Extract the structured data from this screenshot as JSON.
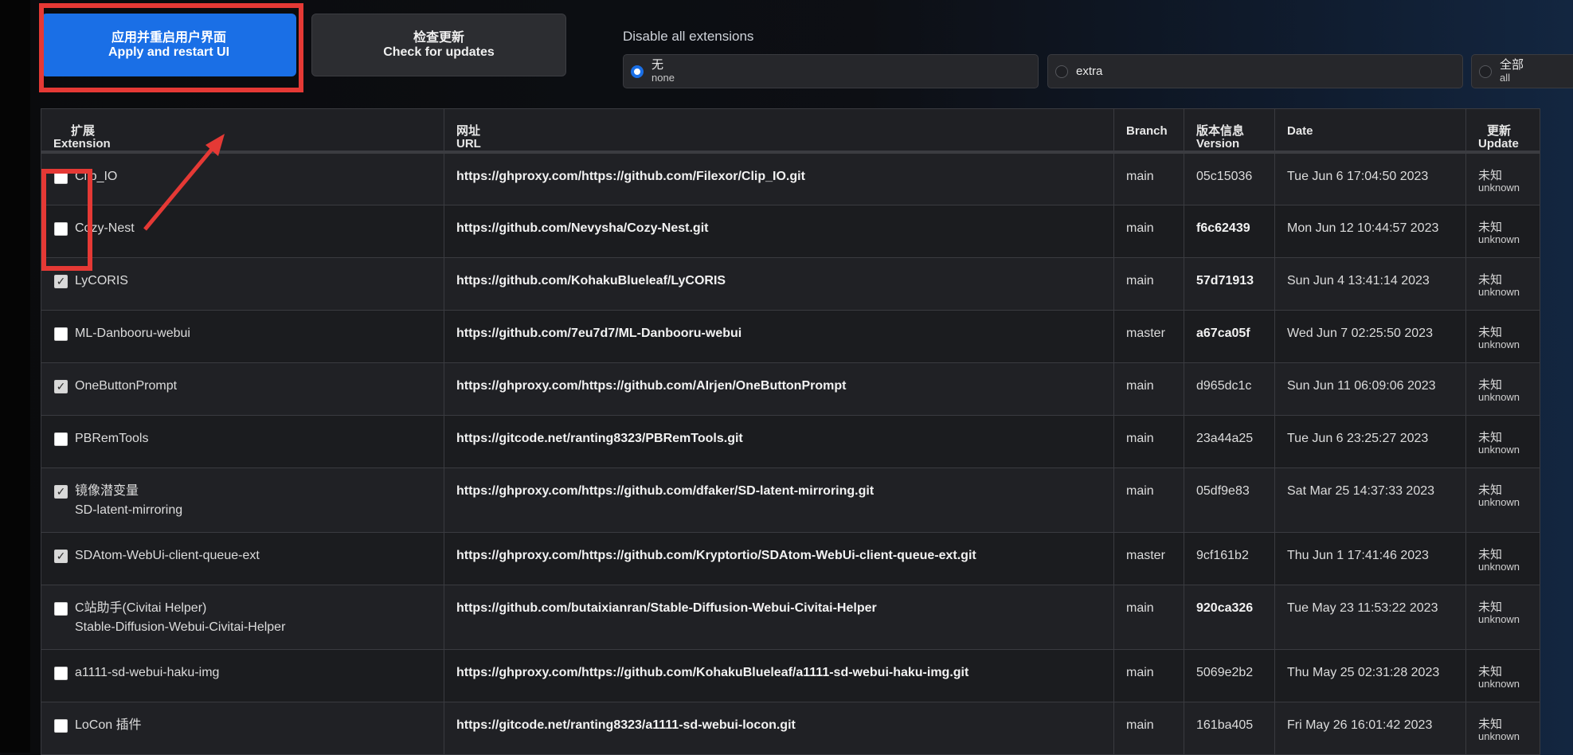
{
  "buttons": {
    "apply": {
      "cn": "应用并重启用户界面",
      "en": "Apply and restart UI"
    },
    "check": {
      "cn": "检查更新",
      "en": "Check for updates"
    }
  },
  "disable": {
    "label": "Disable all extensions",
    "options": [
      {
        "main": "无",
        "sub": "none",
        "checked": true
      },
      {
        "main": "extra",
        "sub": "",
        "checked": false
      },
      {
        "main": "全部",
        "sub": "all",
        "checked": false
      }
    ]
  },
  "table": {
    "headers": {
      "extension": {
        "cn": "扩展",
        "en": "Extension"
      },
      "url": {
        "cn": "网址",
        "en": "URL"
      },
      "branch": {
        "cn": "",
        "en": "Branch"
      },
      "version": {
        "cn": "版本信息",
        "en": "Version"
      },
      "date": {
        "cn": "",
        "en": "Date"
      },
      "update": {
        "cn": "更新",
        "en": "Update"
      }
    },
    "rows": [
      {
        "checked": false,
        "name": "Clip_IO",
        "name2": "",
        "url": "https://ghproxy.com/https://github.com/Filexor/Clip_IO.git",
        "branch": "main",
        "version": "05c15036",
        "version_bold": false,
        "date": "Tue Jun 6 17:04:50 2023",
        "update": "未知",
        "update_sub": "unknown"
      },
      {
        "checked": false,
        "name": "Cozy-Nest",
        "name2": "",
        "url": "https://github.com/Nevysha/Cozy-Nest.git",
        "branch": "main",
        "version": "f6c62439",
        "version_bold": true,
        "date": "Mon Jun 12 10:44:57 2023",
        "update": "未知",
        "update_sub": "unknown"
      },
      {
        "checked": true,
        "name": "LyCORIS",
        "name2": "",
        "url": "https://github.com/KohakuBlueleaf/LyCORIS",
        "branch": "main",
        "version": "57d71913",
        "version_bold": true,
        "date": "Sun Jun 4 13:41:14 2023",
        "update": "未知",
        "update_sub": "unknown"
      },
      {
        "checked": false,
        "name": "ML-Danbooru-webui",
        "name2": "",
        "url": "https://github.com/7eu7d7/ML-Danbooru-webui",
        "branch": "master",
        "version": "a67ca05f",
        "version_bold": true,
        "date": "Wed Jun 7 02:25:50 2023",
        "update": "未知",
        "update_sub": "unknown"
      },
      {
        "checked": true,
        "name": "OneButtonPrompt",
        "name2": "",
        "url": "https://ghproxy.com/https://github.com/AIrjen/OneButtonPrompt",
        "branch": "main",
        "version": "d965dc1c",
        "version_bold": false,
        "date": "Sun Jun 11 06:09:06 2023",
        "update": "未知",
        "update_sub": "unknown"
      },
      {
        "checked": false,
        "name": "PBRemTools",
        "name2": "",
        "url": "https://gitcode.net/ranting8323/PBRemTools.git",
        "branch": "main",
        "version": "23a44a25",
        "version_bold": false,
        "date": "Tue Jun 6 23:25:27 2023",
        "update": "未知",
        "update_sub": "unknown"
      },
      {
        "checked": true,
        "name": "镜像潜变量",
        "name2": "SD-latent-mirroring",
        "url": "https://ghproxy.com/https://github.com/dfaker/SD-latent-mirroring.git",
        "branch": "main",
        "version": "05df9e83",
        "version_bold": false,
        "date": "Sat Mar 25 14:37:33 2023",
        "update": "未知",
        "update_sub": "unknown"
      },
      {
        "checked": true,
        "name": "SDAtom-WebUi-client-queue-ext",
        "name2": "",
        "url": "https://ghproxy.com/https://github.com/Kryptortio/SDAtom-WebUi-client-queue-ext.git",
        "branch": "master",
        "version": "9cf161b2",
        "version_bold": false,
        "date": "Thu Jun 1 17:41:46 2023",
        "update": "未知",
        "update_sub": "unknown"
      },
      {
        "checked": false,
        "name": "C站助手(Civitai Helper)",
        "name2": "Stable-Diffusion-Webui-Civitai-Helper",
        "url": "https://github.com/butaixianran/Stable-Diffusion-Webui-Civitai-Helper",
        "branch": "main",
        "version": "920ca326",
        "version_bold": true,
        "date": "Tue May 23 11:53:22 2023",
        "update": "未知",
        "update_sub": "unknown"
      },
      {
        "checked": false,
        "name": "a1111-sd-webui-haku-img",
        "name2": "",
        "url": "https://ghproxy.com/https://github.com/KohakuBlueleaf/a1111-sd-webui-haku-img.git",
        "branch": "main",
        "version": "5069e2b2",
        "version_bold": false,
        "date": "Thu May 25 02:31:28 2023",
        "update": "未知",
        "update_sub": "unknown"
      },
      {
        "checked": false,
        "name": "LoCon 插件",
        "name2": "",
        "url": "https://gitcode.net/ranting8323/a1111-sd-webui-locon.git",
        "branch": "main",
        "version": "161ba405",
        "version_bold": false,
        "date": "Fri May 26 16:01:42 2023",
        "update": "未知",
        "update_sub": "unknown"
      }
    ]
  }
}
